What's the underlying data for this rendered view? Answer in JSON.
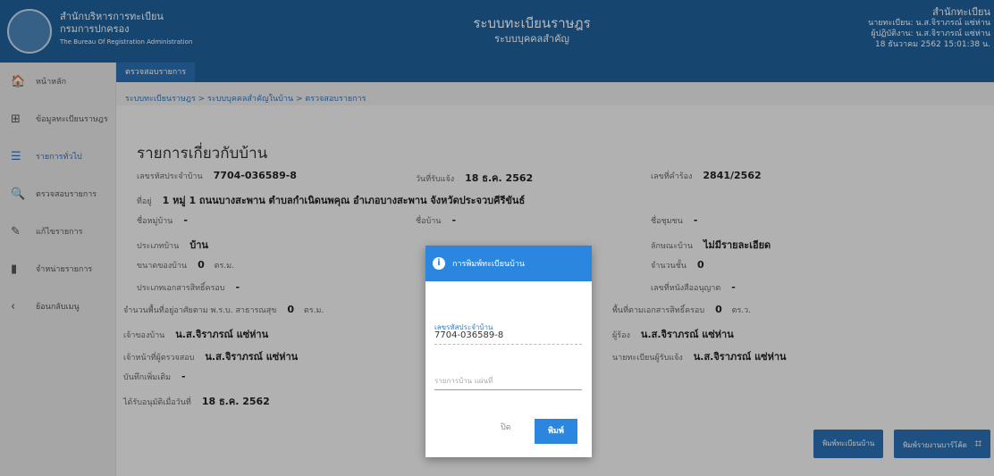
{
  "header": {
    "org_line1": "สำนักบริหารการทะเบียน",
    "org_line2": "กรมการปกครอง",
    "org_line3": "The Bureau Of Registration Administration",
    "system_title": "ระบบทะเบียนราษฎร",
    "system_subtitle": "ระบบบุคคลสำคัญ",
    "user_name": "สำนักทะเบียน",
    "user_line1": "นายทะเบียน: น.ส.จิราภรณ์ แซ่ห่าน",
    "user_line2": "ผู้ปฏิบัติงาน: น.ส.จิราภรณ์ แซ่ห่าน",
    "user_datetime": "18 ธันวาคม 2562 15:01:38 น."
  },
  "sidebar": {
    "items": [
      {
        "icon": "home-icon",
        "glyph": "🏠",
        "label": "หน้าหลัก"
      },
      {
        "icon": "grid-icon",
        "glyph": "⊞",
        "label": "ข้อมูลทะเบียนราษฎร"
      },
      {
        "icon": "list-icon",
        "glyph": "☰",
        "label": "รายการทั่วไป"
      },
      {
        "icon": "search-icon",
        "glyph": "🔍",
        "label": "ตรวจสอบรายการ"
      },
      {
        "icon": "pencil-icon",
        "glyph": "✎",
        "label": "แก้ไขรายการ"
      },
      {
        "icon": "document-icon",
        "glyph": "▮",
        "label": "จำหน่ายรายการ"
      },
      {
        "icon": "back-icon",
        "glyph": "‹",
        "label": "ย้อนกลับเมนู"
      }
    ],
    "active_index": 2
  },
  "tab": {
    "label": "ตรวจสอบรายการ"
  },
  "breadcrumb": "ระบบทะเบียนราษฎร > ระบบบุคคลสำคัญในบ้าน > ตรวจสอบรายการ",
  "content": {
    "title": "รายการเกี่ยวกับบ้าน",
    "house_no_label": "เลขรหัสประจำบ้าน",
    "house_no_value": "7704-036589-8",
    "date_label": "วันที่รับแจ้ง",
    "date_value": "18 ธ.ค. 2562",
    "request_label": "เลขที่คำร้อง",
    "request_value": "2841/2562",
    "address_label": "ที่อยู่",
    "address_value": "1 หมู่ 1 ถนนบางสะพาน ตำบลกำเนิดนพคุณ อำเภอบางสะพาน จังหวัดประจวบคีรีขันธ์",
    "village_label": "ชื่อหมู่บ้าน",
    "village_value": "-",
    "house_name_label": "ชื่อบ้าน",
    "house_name_value": "-",
    "community_label": "ชื่อชุมชน",
    "community_value": "-",
    "house_type_label": "ประเภทบ้าน",
    "house_type_value": "บ้าน",
    "house_character_label": "ลักษณะบ้าน",
    "house_character_value": "ไม่มีรายละเอียด",
    "house_size_label": "ขนาดของบ้าน",
    "house_size_value": "0",
    "house_size_unit": "ตร.ม.",
    "floors_label": "จำนวนชั้น",
    "floors_value": "0",
    "document_type_label": "ประเภทเอกสารสิทธิ์ครอบ",
    "document_type_value": "-",
    "permit_label": "เลขที่หนังสืออนุญาต",
    "permit_value": "-",
    "land_area_label": "จำนวนพื้นที่อยู่อาศัยตาม พ.ร.บ. สาธารณสุข",
    "land_area_value": "0",
    "land_area_unit": "ตร.ม.",
    "doc_area_label": "พื้นที่ตามเอกสารสิทธิ์ครอบ",
    "doc_area_value": "0",
    "doc_area_unit": "ตร.ว.",
    "owner_label": "เจ้าของบ้าน",
    "owner_value": "น.ส.จิราภรณ์ แซ่ห่าน",
    "requester_label": "ผู้ร้อง",
    "requester_value": "น.ส.จิราภรณ์ แซ่ห่าน",
    "inspector_label": "เจ้าหน้าที่ผู้ตรวจสอบ",
    "inspector_value": "น.ส.จิราภรณ์ แซ่ห่าน",
    "registrar_label": "นายทะเบียนผู้รับแจ้ง",
    "registrar_value": "น.ส.จิราภรณ์ แซ่ห่าน",
    "note_label": "บันทึกเพิ่มเติม",
    "note_value": "-",
    "approved_label": "ได้รับอนุมัติเมื่อวันที่",
    "approved_value": "18 ธ.ค. 2562"
  },
  "modal": {
    "title": "การพิมพ์ทะเบียนบ้าน",
    "field_label": "เลขรหัสประจำบ้าน",
    "field_value": "7704-036589-8",
    "input_placeholder": "รายการบ้าน แผ่นที่",
    "close_label": "ปิด",
    "print_label": "พิมพ์"
  },
  "buttons": {
    "print_house_reg": "พิมพ์ทะเบียนบ้าน",
    "print_qr": "พิมพ์รายงานบาร์โค้ด"
  }
}
